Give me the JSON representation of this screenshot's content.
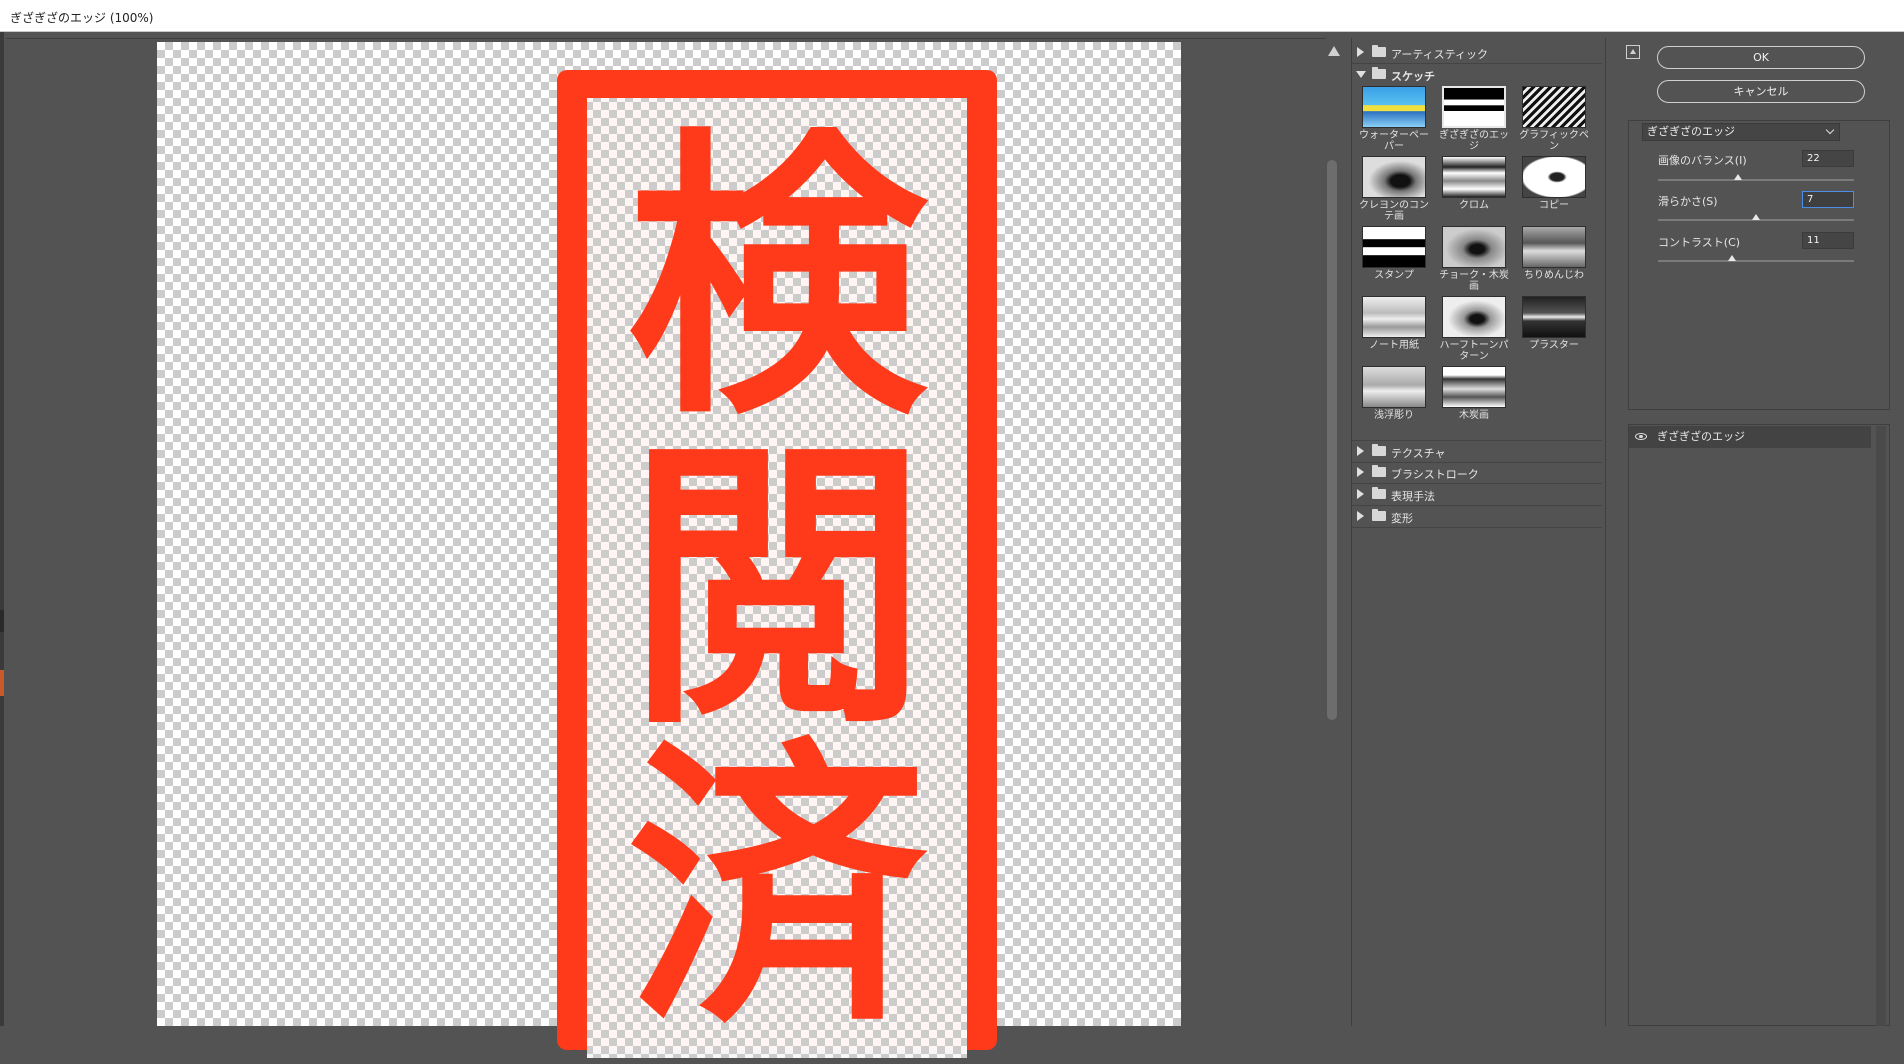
{
  "window": {
    "title": "ぎざぎざのエッジ (100%)"
  },
  "stamp": {
    "chars": [
      "検",
      "閲",
      "済"
    ],
    "color": "#ff3a1a"
  },
  "gallery": {
    "categories_top": [
      {
        "label": "アーティスティック",
        "expanded": false
      },
      {
        "label": "スケッチ",
        "expanded": true
      }
    ],
    "filters": [
      {
        "label": "ウォーターペーパー",
        "icon": "watercolor-paper-thumbnail"
      },
      {
        "label": "ぎざぎざのエッジ",
        "icon": "torn-edges-thumbnail",
        "selected": true
      },
      {
        "label": "グラフィックペン",
        "icon": "graphic-pen-thumbnail"
      },
      {
        "label": "クレヨンのコンテ画",
        "icon": "conte-crayon-thumbnail"
      },
      {
        "label": "クロム",
        "icon": "chrome-thumbnail"
      },
      {
        "label": "コピー",
        "icon": "photocopy-thumbnail"
      },
      {
        "label": "スタンプ",
        "icon": "stamp-thumbnail"
      },
      {
        "label": "チョーク・木炭画",
        "icon": "chalk-charcoal-thumbnail"
      },
      {
        "label": "ちりめんじわ",
        "icon": "reticulation-thumbnail"
      },
      {
        "label": "ノート用紙",
        "icon": "note-paper-thumbnail"
      },
      {
        "label": "ハーフトーンパターン",
        "icon": "halftone-pattern-thumbnail"
      },
      {
        "label": "プラスター",
        "icon": "plaster-thumbnail"
      },
      {
        "label": "浅浮彫り",
        "icon": "bas-relief-thumbnail"
      },
      {
        "label": "木炭画",
        "icon": "charcoal-thumbnail"
      }
    ],
    "categories_bottom": [
      {
        "label": "テクスチャ"
      },
      {
        "label": "ブラシストローク"
      },
      {
        "label": "表現手法"
      },
      {
        "label": "変形"
      }
    ]
  },
  "buttons": {
    "ok": "OK",
    "cancel": "キャンセル"
  },
  "settings": {
    "filter_select": "ぎざぎざのエッジ",
    "params": [
      {
        "label": "画像のバランス(I)",
        "value": "22",
        "fraction": 0.41
      },
      {
        "label": "滑らかさ(S)",
        "value": "7",
        "fraction": 0.5,
        "focused": true
      },
      {
        "label": "コントラスト(C)",
        "value": "11",
        "fraction": 0.38
      }
    ]
  },
  "layers": {
    "items": [
      {
        "label": "ぎざぎざのエッジ"
      }
    ]
  }
}
